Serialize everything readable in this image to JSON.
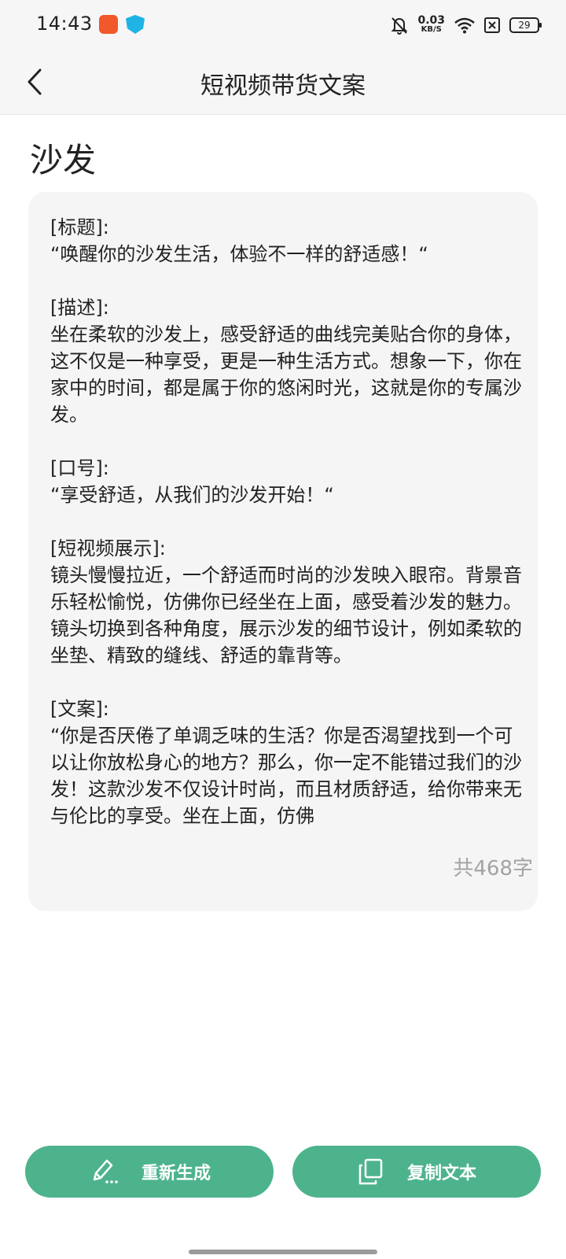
{
  "status_bar": {
    "time": "14:43",
    "net_speed_value": "0.03",
    "net_speed_unit": "KB/S",
    "battery": "29"
  },
  "app_bar": {
    "title": "短视频带货文案"
  },
  "page": {
    "title": "沙发"
  },
  "copy": {
    "sections": [
      {
        "label": "[标题]:",
        "body": "“唤醒你的沙发生活，体验不一样的舒适感！“"
      },
      {
        "label": "[描述]:",
        "body": "坐在柔软的沙发上，感受舒适的曲线完美贴合你的身体，这不仅是一种享受，更是一种生活方式。想象一下，你在家中的时间，都是属于你的悠闲时光，这就是你的专属沙发。"
      },
      {
        "label": "[口号]:",
        "body": "“享受舒适，从我们的沙发开始！“"
      },
      {
        "label": "[短视频展示]:",
        "body": "镜头慢慢拉近，一个舒适而时尚的沙发映入眼帘。背景音乐轻松愉悦，仿佛你已经坐在上面，感受着沙发的魅力。镜头切换到各种角度，展示沙发的细节设计，例如柔软的坐垫、精致的缝线、舒适的靠背等。"
      },
      {
        "label": "[文案]:",
        "body": "“你是否厌倦了单调乏味的生活？你是否渴望找到一个可以让你放松身心的地方？那么，你一定不能错过我们的沙发！这款沙发不仅设计时尚，而且材质舒适，给你带来无与伦比的享受。坐在上面，仿佛"
      }
    ],
    "char_count": "共468字"
  },
  "actions": {
    "regenerate_label": "重新生成",
    "copy_label": "复制文本"
  }
}
